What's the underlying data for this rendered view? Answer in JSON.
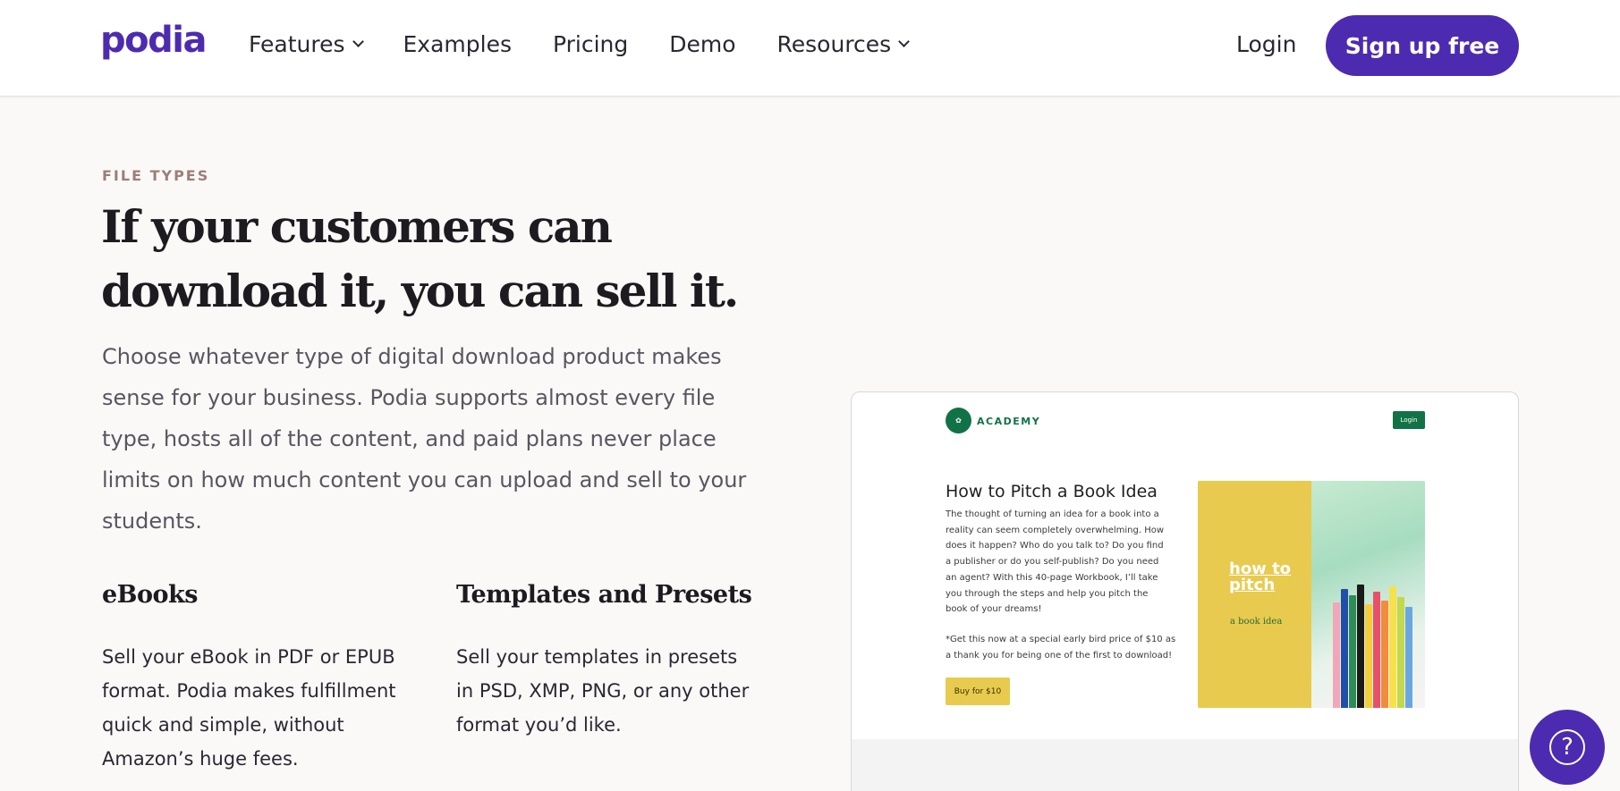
{
  "header": {
    "logo": "podia",
    "nav": [
      {
        "label": "Features",
        "dropdown": true
      },
      {
        "label": "Examples",
        "dropdown": false
      },
      {
        "label": "Pricing",
        "dropdown": false
      },
      {
        "label": "Demo",
        "dropdown": false
      },
      {
        "label": "Resources",
        "dropdown": true
      }
    ],
    "login": "Login",
    "signup": "Sign up free"
  },
  "hero": {
    "eyebrow": "FILE TYPES",
    "headline": "If your customers can download it, you can sell it.",
    "lead": "Choose whatever type of digital download product makes sense for your business. Podia supports almost every file type, hosts all of the content, and paid plans never place limits on how much content you can upload and sell to your students."
  },
  "features": [
    {
      "title": "eBooks",
      "text": "Sell your eBook in PDF or EPUB format. Podia makes fulfillment quick and simple, without Amazon’s huge fees."
    },
    {
      "title": "Templates and Presets",
      "text": "Sell your templates in presets in PSD, XMP, PNG, or any other format you’d like."
    }
  ],
  "preview": {
    "brand": "ACADEMY",
    "login": "Login",
    "title": "How to Pitch a Book Idea",
    "description": "The thought of turning an idea for a book into a reality can seem completely overwhelming. How does it happen? Who do you talk to? Do you find a publisher or do you self-publish? Do you need an agent? With this 40-page Workbook, I’ll take you through the steps and help you pitch the book of your dreams!",
    "note": "*Get this now at a special early bird price of $10 as a thank you for being one of the first to download!",
    "buy": "Buy for $10",
    "cover_title": "how to pitch",
    "cover_subtitle": "a book idea"
  },
  "help": {
    "label": "?"
  },
  "colors": {
    "brand": "#4d2bb0",
    "academy_green": "#127247",
    "cover_yellow": "#e8cb4e",
    "background": "#fbf9f7"
  }
}
